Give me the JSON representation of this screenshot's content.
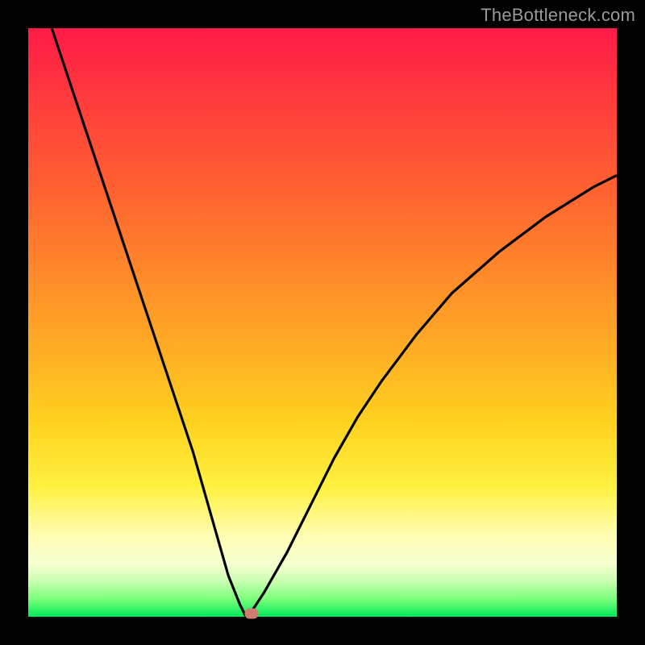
{
  "watermark": "TheBottleneck.com",
  "colors": {
    "frame": "#000000",
    "curve": "#000000",
    "marker": "#d07c74",
    "gradient_top": "#ff1a47",
    "gradient_bottom": "#00e85a"
  },
  "chart_data": {
    "type": "line",
    "title": "",
    "xlabel": "",
    "ylabel": "",
    "xlim": [
      0,
      100
    ],
    "ylim": [
      0,
      100
    ],
    "x": [
      4,
      8,
      12,
      16,
      20,
      24,
      28,
      32,
      34,
      36,
      37,
      38,
      40,
      44,
      48,
      52,
      56,
      60,
      66,
      72,
      80,
      88,
      96,
      100
    ],
    "values": [
      100,
      88,
      76,
      64,
      52,
      40,
      28,
      14,
      7,
      2,
      0,
      1,
      4,
      11,
      19,
      27,
      34,
      40,
      48,
      55,
      62,
      68,
      73,
      75
    ],
    "min_point": {
      "x": 37,
      "y": 0
    },
    "marker": {
      "x": 38,
      "y": 0.5
    },
    "grid": false,
    "legend": false,
    "annotations": []
  }
}
